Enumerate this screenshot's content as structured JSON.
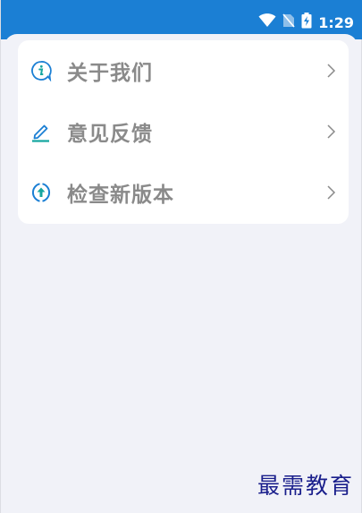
{
  "status_bar": {
    "time": "1:29",
    "background": "#1b7fd4",
    "icons": [
      "wifi-icon",
      "no-sim-icon",
      "battery-charging-icon"
    ]
  },
  "menu": {
    "items": [
      {
        "label": "关于我们",
        "icon": "info-icon"
      },
      {
        "label": "意见反馈",
        "icon": "edit-icon"
      },
      {
        "label": "检查新版本",
        "icon": "update-icon"
      }
    ]
  },
  "watermark": "最需教育",
  "colors": {
    "accent": "#1b7fd4",
    "icon_teal": "#16a6a0",
    "label_gray": "#8a8a8a",
    "page_bg": "#f1f2f8"
  }
}
